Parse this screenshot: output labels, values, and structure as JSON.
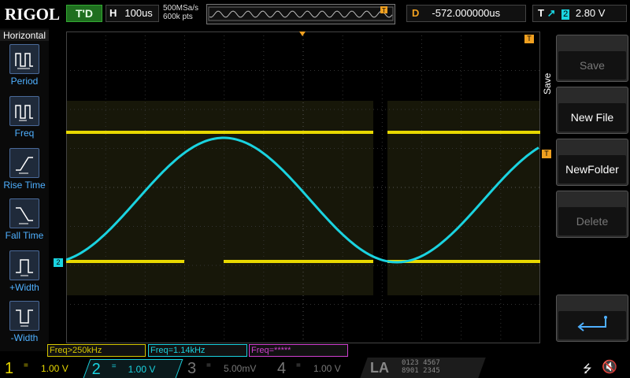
{
  "header": {
    "brand": "RIGOL",
    "run_state": "T'D",
    "timebase_letter": "H",
    "timebase": "100us",
    "sample_rate": "500MSa/s",
    "mem_depth": "600k pts",
    "delay_letter": "D",
    "delay": "-572.000000us",
    "trigger_letter": "T",
    "trigger_source": "2",
    "trigger_level": "2.80 V"
  },
  "sidebar": {
    "title": "Horizontal",
    "items": [
      {
        "label": "Period",
        "icon": "period-icon"
      },
      {
        "label": "Freq",
        "icon": "freq-icon"
      },
      {
        "label": "Rise Time",
        "icon": "rise-time-icon"
      },
      {
        "label": "Fall Time",
        "icon": "fall-time-icon"
      },
      {
        "label": "+Width",
        "icon": "positive-width-icon"
      },
      {
        "label": "-Width",
        "icon": "negative-width-icon"
      }
    ]
  },
  "menu": {
    "title": "Save",
    "buttons": [
      {
        "label": "Save",
        "enabled": false
      },
      {
        "label": "New File",
        "enabled": true
      },
      {
        "label": "NewFolder",
        "enabled": true
      },
      {
        "label": "Delete",
        "enabled": false
      }
    ],
    "enter_icon": "return-arrow-icon"
  },
  "measurements": {
    "m1": "Freq>250kHz",
    "m2": "Freq=1.14kHz",
    "m3": "Freq=*****"
  },
  "channels": {
    "ch1": {
      "num": "1",
      "coupling": "=",
      "scale": "1.00 V"
    },
    "ch2": {
      "num": "2",
      "coupling": "=",
      "scale": "1.00 V"
    },
    "ch3": {
      "num": "3",
      "coupling": "=",
      "scale": "5.00mV"
    },
    "ch4": {
      "num": "4",
      "coupling": "=",
      "scale": "1.00 V"
    },
    "la": "LA",
    "la_row1": "0123 4567",
    "la_row2": "8901 2345"
  },
  "markers": {
    "ch2_ground": "2",
    "trigger_marker": "T"
  },
  "colors": {
    "ch1": "#e8d800",
    "ch2": "#1ad3e0",
    "ch3": "#d040d0",
    "menu_label": "#4fb0ff",
    "trigger": "#f0a020"
  }
}
